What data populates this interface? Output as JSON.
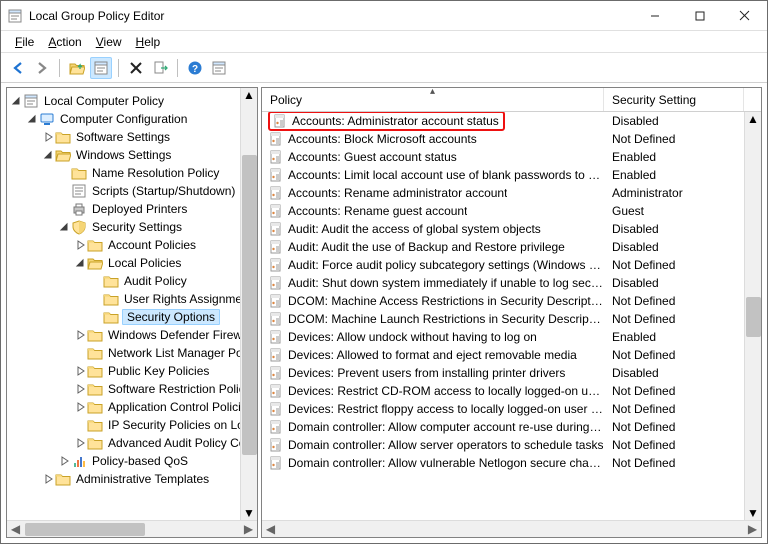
{
  "title": "Local Group Policy Editor",
  "menu": {
    "file": "File",
    "action": "Action",
    "view": "View",
    "help": "Help"
  },
  "columns": {
    "policy": "Policy",
    "setting": "Security Setting"
  },
  "tree": {
    "root": "Local Computer Policy",
    "cc": "Computer Configuration",
    "ss": "Software Settings",
    "ws": "Windows Settings",
    "nrp": "Name Resolution Policy",
    "scripts": "Scripts (Startup/Shutdown)",
    "dp": "Deployed Printers",
    "sec": "Security Settings",
    "ap": "Account Policies",
    "lp": "Local Policies",
    "audit": "Audit Policy",
    "ura": "User Rights Assignment",
    "so": "Security Options",
    "wdf": "Windows Defender Firewall with Advanced Security",
    "nlmp": "Network List Manager Policies",
    "pkp": "Public Key Policies",
    "srp": "Software Restriction Policies",
    "acp": "Application Control Policies",
    "ipsp": "IP Security Policies on Local Computer",
    "aapc": "Advanced Audit Policy Configuration",
    "pqos": "Policy-based QoS",
    "at": "Administrative Templates"
  },
  "rows": [
    {
      "p": "Accounts: Administrator account status",
      "s": "Disabled",
      "hl": true
    },
    {
      "p": "Accounts: Block Microsoft accounts",
      "s": "Not Defined"
    },
    {
      "p": "Accounts: Guest account status",
      "s": "Enabled"
    },
    {
      "p": "Accounts: Limit local account use of blank passwords to co...",
      "s": "Enabled"
    },
    {
      "p": "Accounts: Rename administrator account",
      "s": "Administrator"
    },
    {
      "p": "Accounts: Rename guest account",
      "s": "Guest"
    },
    {
      "p": "Audit: Audit the access of global system objects",
      "s": "Disabled"
    },
    {
      "p": "Audit: Audit the use of Backup and Restore privilege",
      "s": "Disabled"
    },
    {
      "p": "Audit: Force audit policy subcategory settings (Windows Vis...",
      "s": "Not Defined"
    },
    {
      "p": "Audit: Shut down system immediately if unable to log secur...",
      "s": "Disabled"
    },
    {
      "p": "DCOM: Machine Access Restrictions in Security Descriptor D...",
      "s": "Not Defined"
    },
    {
      "p": "DCOM: Machine Launch Restrictions in Security Descriptor D...",
      "s": "Not Defined"
    },
    {
      "p": "Devices: Allow undock without having to log on",
      "s": "Enabled"
    },
    {
      "p": "Devices: Allowed to format and eject removable media",
      "s": "Not Defined"
    },
    {
      "p": "Devices: Prevent users from installing printer drivers",
      "s": "Disabled"
    },
    {
      "p": "Devices: Restrict CD-ROM access to locally logged-on user ...",
      "s": "Not Defined"
    },
    {
      "p": "Devices: Restrict floppy access to locally logged-on user only",
      "s": "Not Defined"
    },
    {
      "p": "Domain controller: Allow computer account re-use during d...",
      "s": "Not Defined"
    },
    {
      "p": "Domain controller: Allow server operators to schedule tasks",
      "s": "Not Defined"
    },
    {
      "p": "Domain controller: Allow vulnerable Netlogon secure chann...",
      "s": "Not Defined"
    }
  ]
}
